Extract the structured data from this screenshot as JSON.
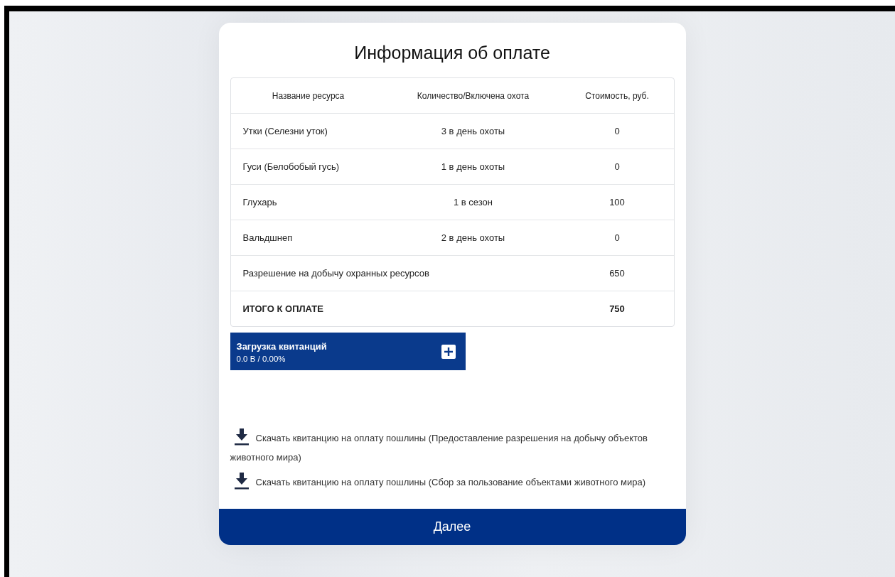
{
  "title": "Информация об оплате",
  "table": {
    "columns": [
      "Название ресурса",
      "Количество/Включена охота",
      "Стоимость, руб."
    ],
    "rows": [
      {
        "kind": "resource",
        "name": "Утки (Селезни уток)",
        "quantity": "3 в день охоты",
        "cost": "0"
      },
      {
        "kind": "resource",
        "name": "Гуси (Белобобый гусь)",
        "quantity": "1 в день охоты",
        "cost": "0"
      },
      {
        "kind": "resource",
        "name": "Глухарь",
        "quantity": "1 в сезон",
        "cost": "100"
      },
      {
        "kind": "resource",
        "name": "Вальдшнеп",
        "quantity": "2 в день охоты",
        "cost": "0"
      },
      {
        "kind": "fee",
        "name": "Разрешение на добычу охранных ресурсов",
        "cost": "650"
      },
      {
        "kind": "total",
        "name": "ИТОГО К ОПЛАТЕ",
        "cost": "750"
      }
    ]
  },
  "upload": {
    "title": "Загрузка квитанций",
    "status": "0.0 B / 0.00%"
  },
  "downloads": [
    "Скачать квитанцию на оплату пошлины (Предоставление разрешения на добычу объектов животного мира)",
    "Скачать квитанцию на оплату пошлины (Сбор за пользование объектами животного мира)"
  ],
  "next_button": "Далее"
}
